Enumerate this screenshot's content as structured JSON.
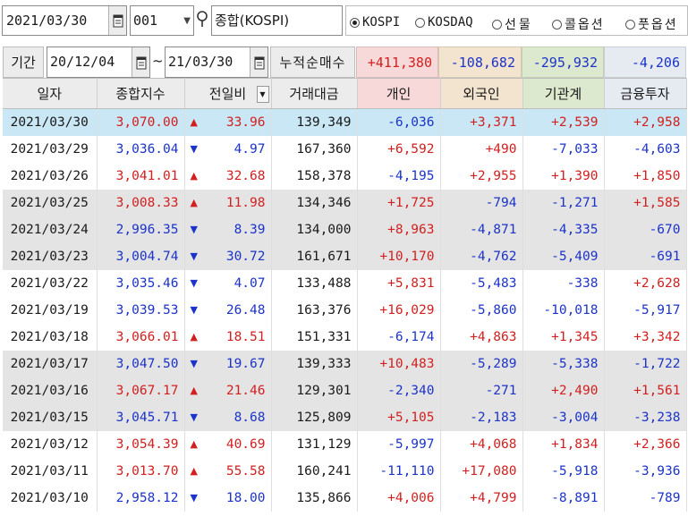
{
  "toolbar": {
    "date": "2021/03/30",
    "code": "001",
    "name": "종합(KOSPI)",
    "markets": [
      {
        "label": "KOSPI",
        "selected": true
      },
      {
        "label": "KOSDAQ",
        "selected": false
      },
      {
        "label": "선물",
        "selected": false
      },
      {
        "label": "콜옵션",
        "selected": false
      },
      {
        "label": "풋옵션",
        "selected": false
      }
    ]
  },
  "filter": {
    "period_label": "기간",
    "from": "20/12/04",
    "tilde": "~",
    "to": "21/03/30",
    "cum_label": "누적순매수",
    "totals": {
      "individual": "+411,380",
      "foreign": "-108,682",
      "institution": "-295,932",
      "finance": "-4,206"
    }
  },
  "colors": {
    "individual_bg": "#f7d9d9",
    "foreign_bg": "#f3e4cf",
    "institution_bg": "#dde9cf",
    "finance_bg": "#e6ebf2"
  },
  "table": {
    "headers": [
      "일자",
      "종합지수",
      "전일비",
      "거래대금",
      "개인",
      "외국인",
      "기관계",
      "금융투자"
    ],
    "rows": [
      {
        "date": "2021/03/30",
        "index": "3,070.00",
        "dir": "up",
        "chg": "33.96",
        "volume": "139,349",
        "ind": "-6,036",
        "frn": "+3,371",
        "ins": "+2,539",
        "fin": "+2,958"
      },
      {
        "date": "2021/03/29",
        "index": "3,036.04",
        "dir": "dn",
        "chg": "4.97",
        "volume": "167,360",
        "ind": "+6,592",
        "frn": "+490",
        "ins": "-7,033",
        "fin": "-4,603"
      },
      {
        "date": "2021/03/26",
        "index": "3,041.01",
        "dir": "up",
        "chg": "32.68",
        "volume": "158,378",
        "ind": "-4,195",
        "frn": "+2,955",
        "ins": "+1,390",
        "fin": "+1,850"
      },
      {
        "date": "2021/03/25",
        "index": "3,008.33",
        "dir": "up",
        "chg": "11.98",
        "volume": "134,346",
        "ind": "+1,725",
        "frn": "-794",
        "ins": "-1,271",
        "fin": "+1,585"
      },
      {
        "date": "2021/03/24",
        "index": "2,996.35",
        "dir": "dn",
        "chg": "8.39",
        "volume": "134,000",
        "ind": "+8,963",
        "frn": "-4,871",
        "ins": "-4,335",
        "fin": "-670"
      },
      {
        "date": "2021/03/23",
        "index": "3,004.74",
        "dir": "dn",
        "chg": "30.72",
        "volume": "161,671",
        "ind": "+10,170",
        "frn": "-4,762",
        "ins": "-5,409",
        "fin": "-691"
      },
      {
        "date": "2021/03/22",
        "index": "3,035.46",
        "dir": "dn",
        "chg": "4.07",
        "volume": "133,488",
        "ind": "+5,831",
        "frn": "-5,483",
        "ins": "-338",
        "fin": "+2,628"
      },
      {
        "date": "2021/03/19",
        "index": "3,039.53",
        "dir": "dn",
        "chg": "26.48",
        "volume": "163,376",
        "ind": "+16,029",
        "frn": "-5,860",
        "ins": "-10,018",
        "fin": "-5,917"
      },
      {
        "date": "2021/03/18",
        "index": "3,066.01",
        "dir": "up",
        "chg": "18.51",
        "volume": "151,331",
        "ind": "-6,174",
        "frn": "+4,863",
        "ins": "+1,345",
        "fin": "+3,342"
      },
      {
        "date": "2021/03/17",
        "index": "3,047.50",
        "dir": "dn",
        "chg": "19.67",
        "volume": "139,333",
        "ind": "+10,483",
        "frn": "-5,289",
        "ins": "-5,338",
        "fin": "-1,722"
      },
      {
        "date": "2021/03/16",
        "index": "3,067.17",
        "dir": "up",
        "chg": "21.46",
        "volume": "129,301",
        "ind": "-2,340",
        "frn": "-271",
        "ins": "+2,490",
        "fin": "+1,561"
      },
      {
        "date": "2021/03/15",
        "index": "3,045.71",
        "dir": "dn",
        "chg": "8.68",
        "volume": "125,809",
        "ind": "+5,105",
        "frn": "-2,183",
        "ins": "-3,004",
        "fin": "-3,238"
      },
      {
        "date": "2021/03/12",
        "index": "3,054.39",
        "dir": "up",
        "chg": "40.69",
        "volume": "131,129",
        "ind": "-5,997",
        "frn": "+4,068",
        "ins": "+1,834",
        "fin": "+2,366"
      },
      {
        "date": "2021/03/11",
        "index": "3,013.70",
        "dir": "up",
        "chg": "55.58",
        "volume": "160,241",
        "ind": "-11,110",
        "frn": "+17,080",
        "ins": "-5,918",
        "fin": "-3,936"
      },
      {
        "date": "2021/03/10",
        "index": "2,958.12",
        "dir": "dn",
        "chg": "18.00",
        "volume": "135,866",
        "ind": "+4,006",
        "frn": "+4,799",
        "ins": "-8,891",
        "fin": "-789"
      }
    ]
  }
}
